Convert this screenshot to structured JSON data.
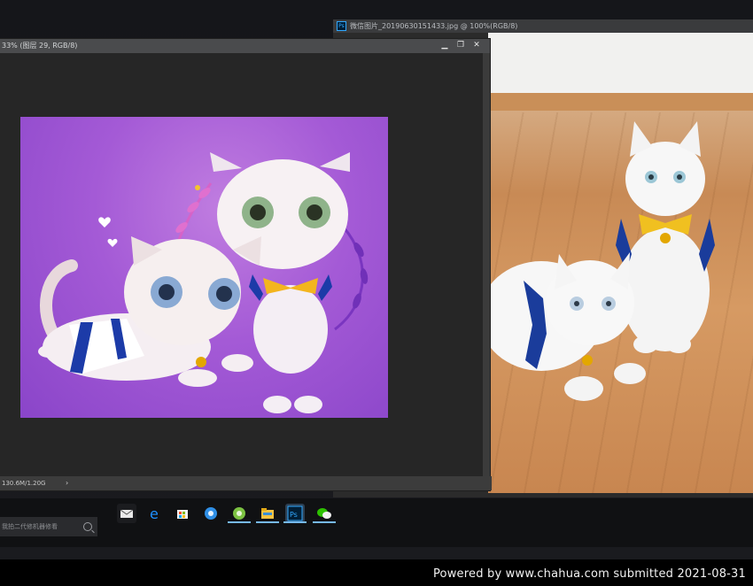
{
  "back_window": {
    "title": "微信图片_20190630151433.jpg @ 100%(RGB/8)"
  },
  "front_window": {
    "title": "33% (图层 29, RGB/8)",
    "status": "130.6M/1.20G",
    "status_arrow": "›",
    "minimize": "▁",
    "restore": "❐",
    "close": "✕"
  },
  "taskbar": {
    "search_placeholder": "我拍二代修机器修看"
  },
  "footer": {
    "text": "Powered  by  www.chahua.com  submitted  2021-08-31"
  },
  "colors": {
    "ps_accent": "#31a8ff",
    "art_purple": "#a45ad6",
    "floor_wood": "#c88a55"
  }
}
